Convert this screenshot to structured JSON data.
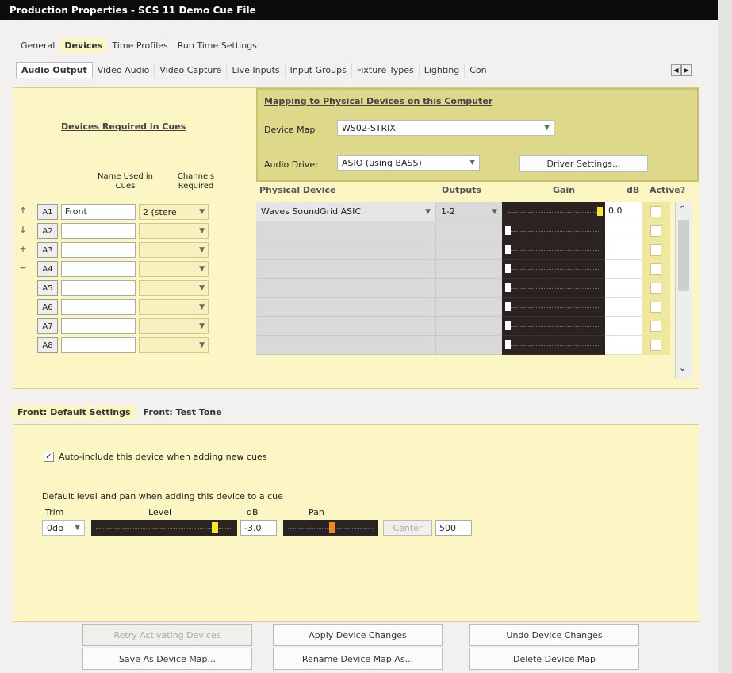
{
  "window": {
    "title": "Production Properties - SCS 11 Demo Cue File"
  },
  "tabs_main": [
    "General",
    "Devices",
    "Time Profiles",
    "Run Time Settings"
  ],
  "tabs_main_selected": 1,
  "tabs_device": [
    "Audio Output",
    "Video Audio",
    "Video Capture",
    "Live Inputs",
    "Input Groups",
    "Fixture Types",
    "Lighting",
    "Con"
  ],
  "tabs_device_selected": 0,
  "left": {
    "heading": "Devices Required in Cues",
    "col_name": "Name Used in Cues",
    "col_channels": "Channels Required"
  },
  "mapping": {
    "heading": "Mapping to Physical Devices on this Computer",
    "device_map_label": "Device Map",
    "device_map_value": "WS02-STRIX",
    "audio_driver_label": "Audio Driver",
    "audio_driver_value": "ASIO (using BASS)",
    "driver_settings_button": "Driver Settings..."
  },
  "grid": {
    "col_physical": "Physical Device",
    "col_outputs": "Outputs",
    "col_gain": "Gain",
    "col_db": "dB",
    "col_active": "Active?"
  },
  "rows": [
    {
      "id": "A1",
      "name": "Front",
      "channels": "2 (stere",
      "device": "Waves SoundGrid ASIC",
      "outputs": "1-2",
      "gain": 1.0,
      "db": "0.0"
    },
    {
      "id": "A2",
      "name": "",
      "channels": "",
      "device": "",
      "outputs": "",
      "gain": 0.0,
      "db": ""
    },
    {
      "id": "A3",
      "name": "",
      "channels": "",
      "device": "",
      "outputs": "",
      "gain": 0.0,
      "db": ""
    },
    {
      "id": "A4",
      "name": "",
      "channels": "",
      "device": "",
      "outputs": "",
      "gain": 0.0,
      "db": ""
    },
    {
      "id": "A5",
      "name": "",
      "channels": "",
      "device": "",
      "outputs": "",
      "gain": 0.0,
      "db": ""
    },
    {
      "id": "A6",
      "name": "",
      "channels": "",
      "device": "",
      "outputs": "",
      "gain": 0.0,
      "db": ""
    },
    {
      "id": "A7",
      "name": "",
      "channels": "",
      "device": "",
      "outputs": "",
      "gain": 0.0,
      "db": ""
    },
    {
      "id": "A8",
      "name": "",
      "channels": "",
      "device": "",
      "outputs": "",
      "gain": 0.0,
      "db": ""
    }
  ],
  "row_buttons": [
    "↑",
    "↓",
    "+",
    "−"
  ],
  "bottom": {
    "tab1": "Front: Default Settings",
    "tab2": "Front: Test Tone",
    "auto_include": "Auto-include this device when adding new cues",
    "default_text": "Default level and pan when adding this device to a cue",
    "trim_label": "Trim",
    "level_label": "Level",
    "db_label": "dB",
    "pan_label": "Pan",
    "trim_value": "0db",
    "db_value": "-3.0",
    "center_button": "Center",
    "pan_value": "500",
    "level_fraction": 0.87,
    "pan_fraction": 0.5
  },
  "buttons": {
    "retry": "Retry Activating Devices",
    "apply": "Apply Device Changes",
    "undo": "Undo Device Changes",
    "save_as": "Save As Device Map...",
    "rename": "Rename Device Map As...",
    "delete": "Delete Device Map"
  },
  "colors": {
    "panel": "#fbf6c4",
    "mapbox": "#ded88a",
    "gain_bg": "#2a2321",
    "thumb_yellow": "#f5e633",
    "pan_thumb": "#f08a24"
  }
}
